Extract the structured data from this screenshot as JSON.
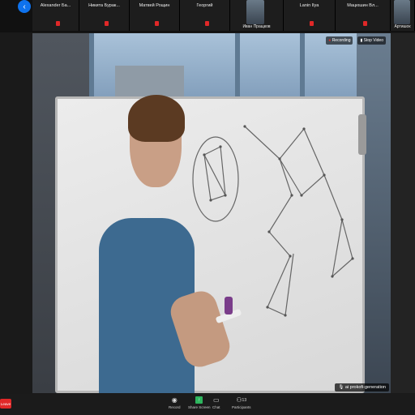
{
  "strip": {
    "participants": [
      {
        "name": "Alexander Ба...",
        "video": false
      },
      {
        "name": "Никита Бурак...",
        "video": false
      },
      {
        "name": "Матвей Рощин",
        "video": false
      },
      {
        "name": "Георгий",
        "video": false
      },
      {
        "name": "Иван Пращков",
        "video": true
      },
      {
        "name": "Lanin Ilya",
        "video": false
      },
      {
        "name": "Мацюшин Вл...",
        "video": false
      },
      {
        "name": "Артишок",
        "video": true
      }
    ]
  },
  "video": {
    "recording_label": "Recording",
    "stop_video_label": "Stop Video",
    "speaker_name": "ai prokofi-generation"
  },
  "toolbar": {
    "leave_label": "Leave",
    "buttons": [
      {
        "label": "Record",
        "icon": "record-icon"
      },
      {
        "label": "Share Screen",
        "icon": "share-screen-icon"
      },
      {
        "label": "Chat",
        "icon": "chat-icon"
      },
      {
        "label": "Participants",
        "icon": "participants-icon",
        "count": "13"
      }
    ]
  },
  "colors": {
    "accent": "#0e72ed",
    "danger": "#e02828",
    "share": "#2db55d"
  }
}
